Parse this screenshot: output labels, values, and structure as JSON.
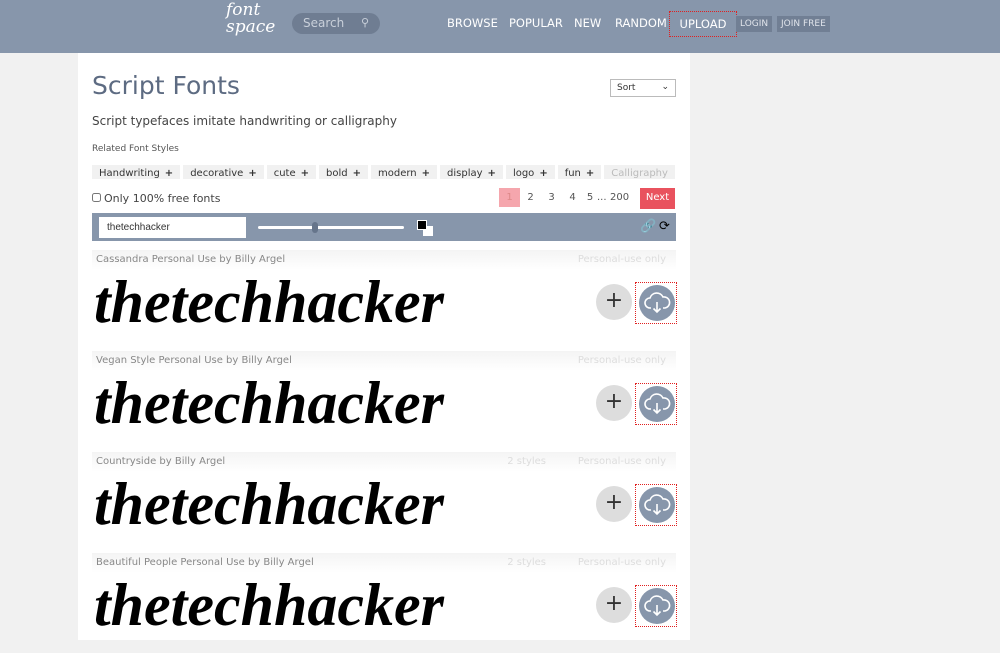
{
  "header": {
    "logo": [
      "font",
      "space"
    ],
    "search_placeholder": "Search",
    "nav": [
      "BROWSE",
      "POPULAR",
      "NEW",
      "RANDOM"
    ],
    "upload": "UPLOAD",
    "login": "LOGIN",
    "join": "JOIN FREE"
  },
  "page": {
    "title": "Script Fonts",
    "sort": "Sort",
    "description": "Script typefaces imitate handwriting or calligraphy",
    "related_label": "Related Font Styles",
    "tags": [
      "Handwriting",
      "decorative",
      "cute",
      "bold",
      "modern",
      "display",
      "logo",
      "fun",
      "Calligraphy"
    ],
    "free_only": "Only 100% free fonts",
    "pagination": [
      "1",
      "2",
      "3",
      "4",
      "5",
      "...",
      "200"
    ],
    "next": "Next",
    "preview_text": "thetechhacker"
  },
  "fonts": [
    {
      "name": "Cassandra Personal Use by Billy Argel",
      "styles": "",
      "license": "Personal-use only"
    },
    {
      "name": "Vegan Style Personal Use by Billy Argel",
      "styles": "",
      "license": "Personal-use only"
    },
    {
      "name": "Countryside by Billy Argel",
      "styles": "2 styles",
      "license": "Personal-use only"
    },
    {
      "name": "Beautiful People Personal Use by Billy Argel",
      "styles": "2 styles",
      "license": "Personal-use only"
    }
  ]
}
